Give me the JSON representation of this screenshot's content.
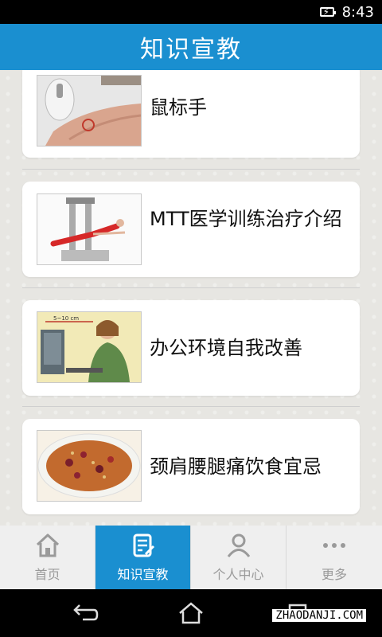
{
  "status_bar": {
    "time": "8:43"
  },
  "header": {
    "title": "知识宣教"
  },
  "articles": [
    {
      "title": "鼠标手",
      "image_icon": "mouse-hand-photo"
    },
    {
      "title": "MTT医学训练治疗介绍",
      "image_icon": "training-machine-photo"
    },
    {
      "title": "办公环境自我改善",
      "image_icon": "office-ergonomics-illustration"
    },
    {
      "title": "颈肩腰腿痛饮食宜忌",
      "image_icon": "porridge-photo"
    }
  ],
  "bottom_nav": [
    {
      "label": "首页",
      "icon": "home-icon",
      "active": false
    },
    {
      "label": "知识宣教",
      "icon": "document-edit-icon",
      "active": true
    },
    {
      "label": "个人中心",
      "icon": "user-icon",
      "active": false
    },
    {
      "label": "更多",
      "icon": "more-dots-icon",
      "active": false
    }
  ],
  "watermark": "ZHAODANJI.COM",
  "colors": {
    "primary": "#1a8fd0",
    "background": "#e7e6e2",
    "card": "#ffffff"
  }
}
